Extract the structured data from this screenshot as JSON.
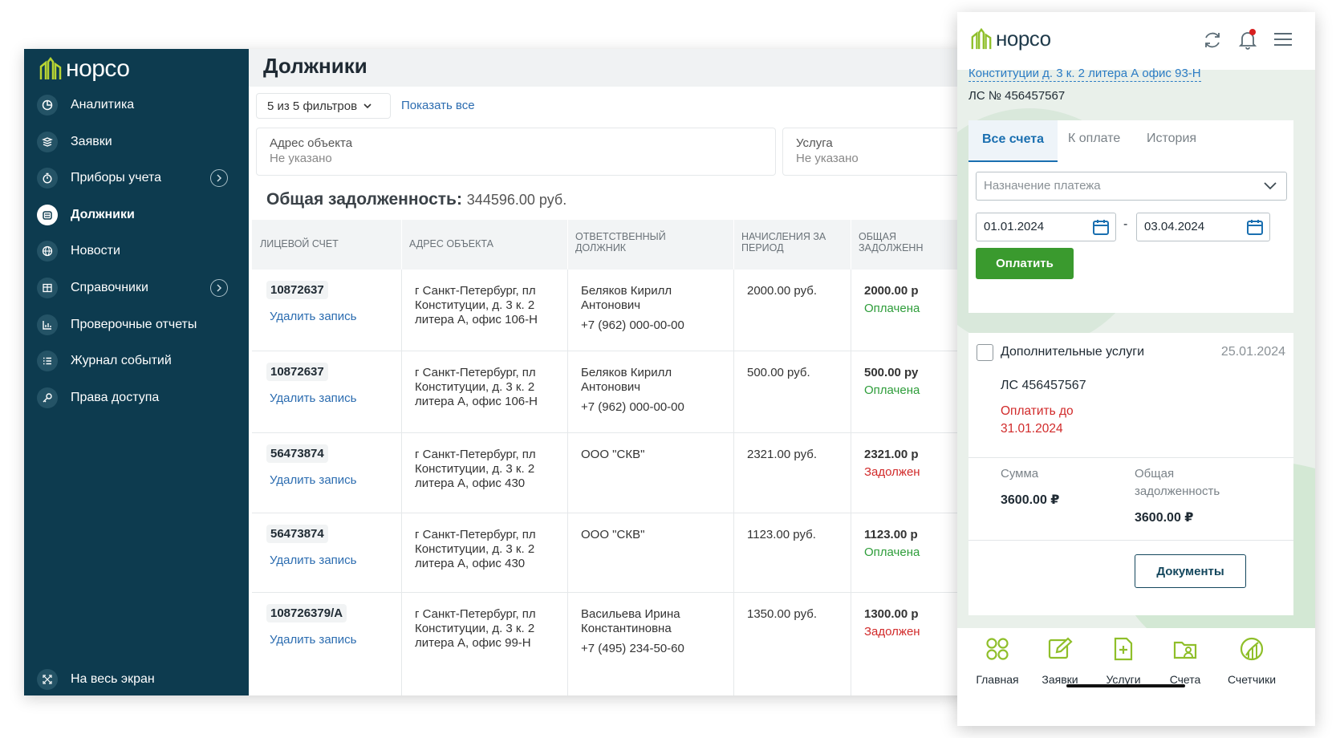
{
  "brand": {
    "name": "норсо",
    "accent": "#0d3b4f",
    "green": "#3a9a2e"
  },
  "sidebar": {
    "items": [
      {
        "label": "Аналитика",
        "icon": "chart-pie-icon"
      },
      {
        "label": "Заявки",
        "icon": "layers-icon"
      },
      {
        "label": "Приборы учета",
        "icon": "stopwatch-icon",
        "has_submenu": true
      },
      {
        "label": "Должники",
        "icon": "coins-icon",
        "active": true
      },
      {
        "label": "Новости",
        "icon": "globe-icon"
      },
      {
        "label": "Справочники",
        "icon": "table-icon",
        "has_submenu": true
      },
      {
        "label": "Проверочные отчеты",
        "icon": "bar-report-icon"
      },
      {
        "label": "Журнал событий",
        "icon": "list-icon"
      },
      {
        "label": "Права доступа",
        "icon": "key-icon"
      }
    ],
    "fullscreen_label": "На весь экран"
  },
  "main": {
    "title": "Должники",
    "filter_button": "5 из 5 фильтров",
    "show_all": "Показать все",
    "filters": [
      {
        "label": "Адрес объекта",
        "value": "Не указано"
      },
      {
        "label": "Услуга",
        "value": "Не указано"
      }
    ],
    "total_label": "Общая задолженность:",
    "total_value": "344596.00 руб.",
    "columns": [
      "Лицевой счет",
      "Адрес объекта",
      "Ответственный должник",
      "Начисления за период",
      "Общая задолженн"
    ],
    "delete_label": "Удалить запись",
    "rows": [
      {
        "account": "10872637",
        "address": [
          "г Санкт-Петербург, пл",
          "Конституции, д. 3 к. 2",
          "литера А, офис 106-Н"
        ],
        "debtor": [
          "Беляков Кирилл",
          "Антонович"
        ],
        "phone": "+7 (962) 000-00-00",
        "accrued": "2000.00 руб.",
        "total": "2000.00 р",
        "status": "Оплачена",
        "status_type": "ok"
      },
      {
        "account": "10872637",
        "address": [
          "г Санкт-Петербург, пл",
          "Конституции, д. 3 к. 2",
          "литера А, офис 106-Н"
        ],
        "debtor": [
          "Беляков Кирилл",
          "Антонович"
        ],
        "phone": "+7 (962) 000-00-00",
        "accrued": "500.00 руб.",
        "total": "500.00 ру",
        "status": "Оплачена",
        "status_type": "ok"
      },
      {
        "account": "56473874",
        "address": [
          "г Санкт-Петербург, пл",
          "Конституции, д. 3 к. 2",
          "литера А, офис 430"
        ],
        "debtor": [
          "ООО \"СКВ\""
        ],
        "phone": "",
        "accrued": "2321.00 руб.",
        "total": "2321.00 р",
        "status": "Задолжен",
        "status_type": "debt"
      },
      {
        "account": "56473874",
        "address": [
          "г Санкт-Петербург, пл",
          "Конституции, д. 3 к. 2",
          "литера А, офис 430"
        ],
        "debtor": [
          "ООО \"СКВ\""
        ],
        "phone": "",
        "accrued": "1123.00 руб.",
        "total": "1123.00 р",
        "status": "Оплачена",
        "status_type": "ok"
      },
      {
        "account": "108726379/А",
        "address": [
          "г Санкт-Петербург, пл",
          "Конституции, д. 3 к. 2",
          "литера А, офис 99-Н"
        ],
        "debtor": [
          "Васильева Ирина",
          "Константиновна"
        ],
        "phone": "+7 (495) 234-50-60",
        "accrued": "1350.00 руб.",
        "total": "1300.00 р",
        "status": "Задолжен",
        "status_type": "debt"
      }
    ]
  },
  "mobile": {
    "address_link": "Конституции д. 3 к. 2 литера А офис 93-Н",
    "ls": "ЛС № 456457567",
    "tabs": [
      "Все счета",
      "К оплате",
      "История"
    ],
    "purpose_placeholder": "Назначение платежа",
    "date_from": "01.01.2024",
    "date_dash": "-",
    "date_to": "03.04.2024",
    "pay_button": "Оплатить",
    "service": {
      "title": "Дополнительные услуги",
      "date": "25.01.2024",
      "ls": "ЛС 456457567",
      "due_line1": "Оплатить до",
      "due_line2": "31.01.2024",
      "sum_label": "Сумма",
      "sum_value": "3600.00 ₽",
      "debt_label_1": "Общая",
      "debt_label_2": "задолженность",
      "debt_value": "3600.00 ₽",
      "docs_button": "Документы"
    },
    "nav": [
      {
        "label": "Главная",
        "icon": "grid-circles-icon"
      },
      {
        "label": "Заявки",
        "icon": "edit-icon"
      },
      {
        "label": "Услуги",
        "icon": "doc-plus-icon"
      },
      {
        "label": "Счета",
        "icon": "folder-user-icon"
      },
      {
        "label": "Счетчики",
        "icon": "gauge-icon"
      }
    ]
  }
}
